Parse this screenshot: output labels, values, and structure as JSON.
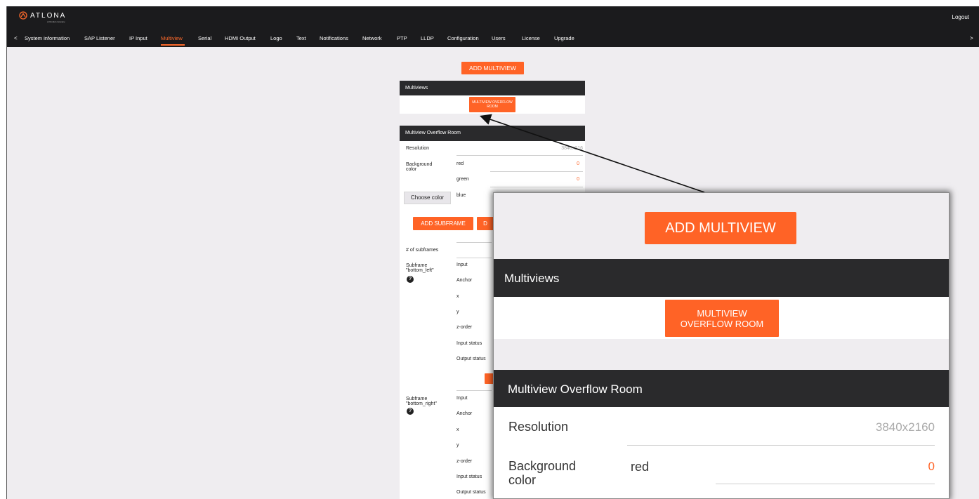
{
  "header": {
    "brand": "ATLONA",
    "brand_sub": "a Panduit company",
    "logout": "Logout"
  },
  "nav": {
    "prev": "<",
    "next": ">",
    "tabs": [
      {
        "label": "System information"
      },
      {
        "label": "SAP Listener"
      },
      {
        "label": "IP Input"
      },
      {
        "label": "Multiview"
      },
      {
        "label": "Serial"
      },
      {
        "label": "HDMI Output"
      },
      {
        "label": "Logo"
      },
      {
        "label": "Text"
      },
      {
        "label": "Notifications"
      },
      {
        "label": "Network"
      },
      {
        "label": "PTP"
      },
      {
        "label": "LLDP"
      },
      {
        "label": "Configuration"
      },
      {
        "label": "Users"
      },
      {
        "label": "License"
      },
      {
        "label": "Upgrade"
      }
    ],
    "active_tab": "Multiview"
  },
  "main": {
    "add_multiview": "ADD MULTIVIEW",
    "multiviews_header": "Multiviews",
    "multiview_item": "MULTIVIEW OVERFLOW ROOM",
    "room_header": "Multiview Overflow Room",
    "resolution_label": "Resolution",
    "resolution_value": "3840x2160",
    "resolution_value_partial": "3840x216",
    "background_label": "Background color",
    "red_label": "red",
    "red_value": "0",
    "green_label": "green",
    "green_value": "0",
    "blue_label": "blue",
    "choose_color": "Choose color",
    "add_subframe": "ADD SUBFRAME",
    "second_button_partial": "D",
    "num_subframes_label": "# of subframes",
    "subframes": [
      {
        "title": "Subframe \"bottom_left\"",
        "fields": [
          "Input",
          "Anchor",
          "x",
          "y",
          "z-order",
          "Input status",
          "Output status"
        ]
      },
      {
        "title": "Subframe \"bottom_right\"",
        "fields": [
          "Input",
          "Anchor",
          "x",
          "y",
          "z-order",
          "Input status",
          "Output status"
        ]
      }
    ]
  },
  "colors": {
    "accent": "#ff6326",
    "topbar": "#1b1b1d",
    "section_header": "#2a2a2c",
    "background": "#efedf0"
  }
}
